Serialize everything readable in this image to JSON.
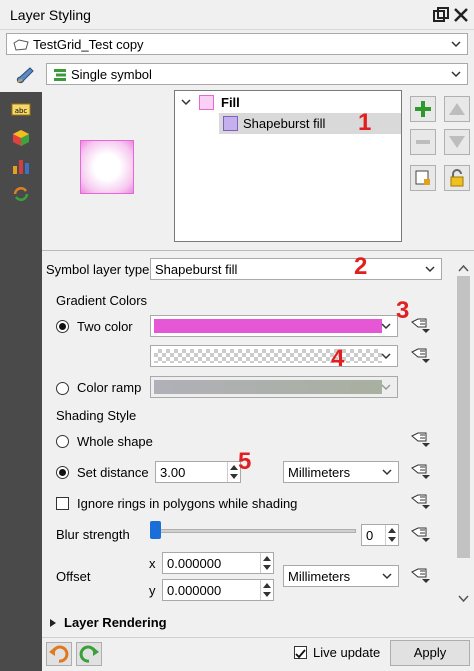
{
  "window": {
    "title": "Layer Styling"
  },
  "layer_selector": {
    "value": "TestGrid_Test copy"
  },
  "renderer_selector": {
    "value": "Single symbol"
  },
  "symbol_tree": {
    "root_label": "Fill",
    "child_label": "Shapeburst fill"
  },
  "symbol_layer_type": {
    "label": "Symbol layer type",
    "value": "Shapeburst fill"
  },
  "gradient": {
    "heading": "Gradient Colors",
    "two_color_label": "Two color",
    "color1": "#e657d6",
    "color_ramp_label": "Color ramp"
  },
  "shading": {
    "heading": "Shading Style",
    "whole_shape_label": "Whole shape",
    "set_distance_label": "Set distance",
    "distance_value": "3.00",
    "distance_unit": "Millimeters",
    "ignore_rings_label": "Ignore rings in polygons while shading"
  },
  "blur": {
    "label": "Blur strength",
    "value": "0",
    "level": 0
  },
  "offset": {
    "label": "Offset",
    "x_label": "x",
    "x_value": "0.000000",
    "y_label": "y",
    "y_value": "0.000000",
    "unit": "Millimeters"
  },
  "layer_rendering": {
    "label": "Layer Rendering"
  },
  "footer": {
    "live_update_label": "Live update",
    "apply_label": "Apply"
  },
  "annotations": [
    "1",
    "2",
    "3",
    "4",
    "5"
  ]
}
